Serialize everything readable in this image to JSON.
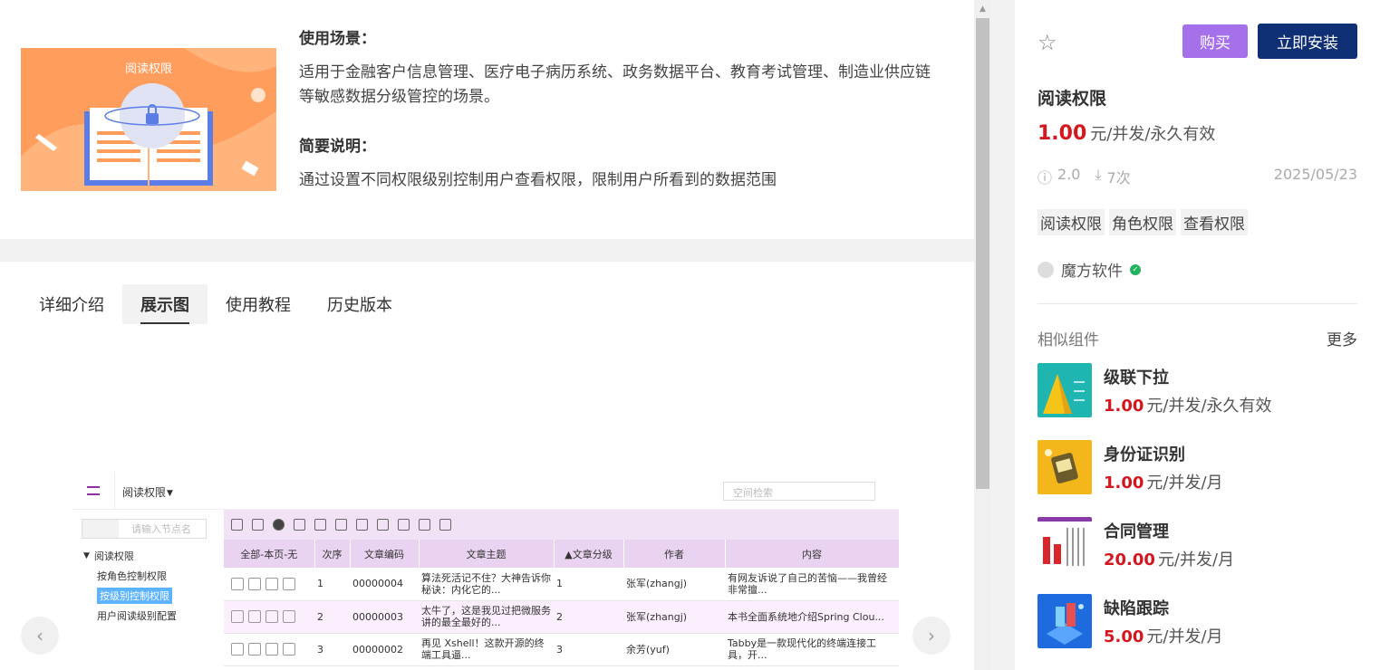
{
  "desc": {
    "scenario_heading": "使用场景：",
    "scenario_text_line1": "适用于金融客户信息管理、医疗电子病历系统、政务数据平台、教育考试管理、制造业供应链",
    "scenario_text_line2": "等敏感数据分级管控的场景。",
    "brief_heading": "简要说明：",
    "brief_text": "通过设置不同权限级别控制用户查看权限，限制用户所看到的数据范围",
    "hero_image_caption": "阅读权限"
  },
  "tabs": [
    {
      "label": "详细介绍"
    },
    {
      "label": "展示图"
    },
    {
      "label": "使用教程"
    },
    {
      "label": "历史版本"
    }
  ],
  "preview": {
    "menu_title": "阅读权限",
    "search_placeholder": "空间检索",
    "tree_search_placeholder": "请输入节点名",
    "tree": [
      {
        "label": "阅读权限"
      },
      {
        "label": "按角色控制权限"
      },
      {
        "label": "按级别控制权限"
      },
      {
        "label": "用户阅读级别配置"
      }
    ],
    "columns": [
      "全部-本页-无",
      "次序",
      "文章编码",
      "文章主题",
      "▲文章分级",
      "作者",
      "内容"
    ],
    "rows": [
      {
        "order": "1",
        "code": "00000004",
        "topic": "算法死活记不住？大神告诉你秘诀：内化它的...",
        "level": "1",
        "author": "张军(zhangj)",
        "content": "有网友诉说了自己的苦恼——我曾经非常擅..."
      },
      {
        "order": "2",
        "code": "00000003",
        "topic": "太牛了，这是我见过把微服务讲的最全最好的...",
        "level": "2",
        "author": "张军(zhangj)",
        "content": "本书全面系统地介绍Spring Clou..."
      },
      {
        "order": "3",
        "code": "00000002",
        "topic": "再见 Xshell！这款开源的终端工具逼...",
        "level": "3",
        "author": "余芳(yuf)",
        "content": "Tabby是一款现代化的终端连接工具，开..."
      }
    ]
  },
  "side": {
    "buy_label": "购买",
    "install_label": "立即安装",
    "title": "阅读权限",
    "price": "1.00",
    "price_unit": "元/并发/永久有效",
    "version": "2.0",
    "downloads": "7次",
    "date": "2025/05/23",
    "tags": [
      "阅读权限",
      "角色权限",
      "查看权限"
    ],
    "author": "魔方软件",
    "similar_heading": "相似组件",
    "more_label": "更多",
    "similar": [
      {
        "name": "级联下拉",
        "price": "1.00",
        "unit": "元/并发/永久有效"
      },
      {
        "name": "身份证识别",
        "price": "1.00",
        "unit": "元/并发/月"
      },
      {
        "name": "合同管理",
        "price": "20.00",
        "unit": "元/并发/月"
      },
      {
        "name": "缺陷跟踪",
        "price": "5.00",
        "unit": "元/并发/月"
      }
    ]
  },
  "colors": {
    "accent_purple": "#a571ea",
    "install_navy": "#0e2f74",
    "price_red": "#d4171f"
  }
}
